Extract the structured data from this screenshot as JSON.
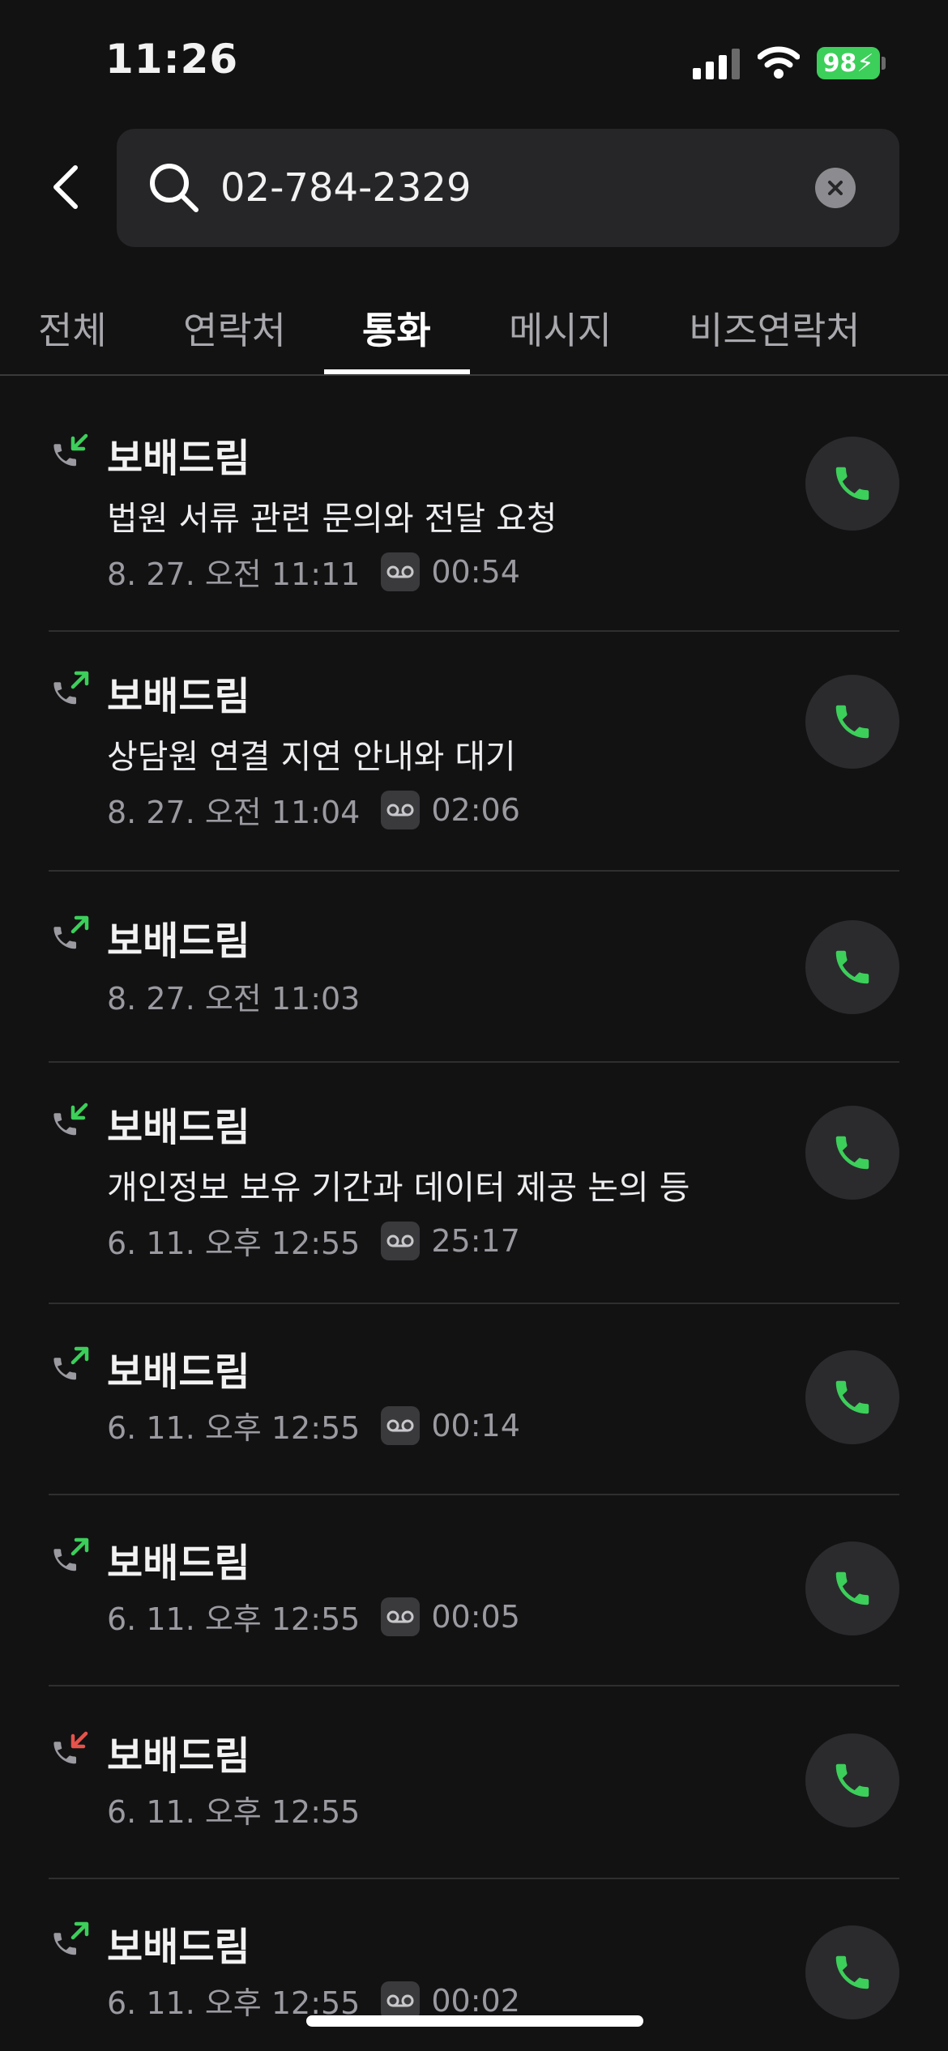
{
  "status_bar": {
    "time": "11:26",
    "battery": "98"
  },
  "search": {
    "value": "02-784-2329"
  },
  "tabs": [
    {
      "label": "전체"
    },
    {
      "label": "연락처"
    },
    {
      "label": "통화",
      "active": true
    },
    {
      "label": "메시지"
    },
    {
      "label": "비즈연락처"
    }
  ],
  "colors": {
    "accent_green": "#3ccf5a",
    "missed_red": "#e5534b",
    "background": "#121213"
  },
  "calls": [
    {
      "name": "보배드림",
      "direction": "incoming",
      "summary": "법원 서류 관련 문의와 전달 요청",
      "datetime": "8. 27. 오전 11:11",
      "has_recording": true,
      "duration": "00:54"
    },
    {
      "name": "보배드림",
      "direction": "outgoing",
      "summary": "상담원 연결 지연 안내와 대기",
      "datetime": "8. 27. 오전 11:04",
      "has_recording": true,
      "duration": "02:06"
    },
    {
      "name": "보배드림",
      "direction": "outgoing",
      "summary": "",
      "datetime": "8. 27. 오전 11:03",
      "has_recording": false,
      "duration": ""
    },
    {
      "name": "보배드림",
      "direction": "incoming",
      "summary": "개인정보 보유 기간과 데이터 제공 논의 등",
      "datetime": "6. 11. 오후 12:55",
      "has_recording": true,
      "duration": "25:17"
    },
    {
      "name": "보배드림",
      "direction": "outgoing",
      "summary": "",
      "datetime": "6. 11. 오후 12:55",
      "has_recording": true,
      "duration": "00:14"
    },
    {
      "name": "보배드림",
      "direction": "outgoing",
      "summary": "",
      "datetime": "6. 11. 오후 12:55",
      "has_recording": true,
      "duration": "00:05"
    },
    {
      "name": "보배드림",
      "direction": "missed",
      "summary": "",
      "datetime": "6. 11. 오후 12:55",
      "has_recording": false,
      "duration": ""
    },
    {
      "name": "보배드림",
      "direction": "outgoing",
      "summary": "",
      "datetime": "6. 11. 오후 12:55",
      "has_recording": true,
      "duration": "00:02"
    }
  ]
}
